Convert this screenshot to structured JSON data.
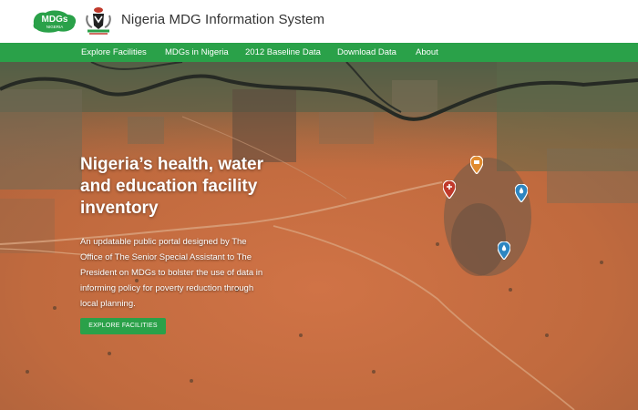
{
  "header": {
    "logo_text": "MDGs",
    "logo_subtext": "NIGERIA",
    "title": "Nigeria MDG Information System"
  },
  "nav": {
    "items": [
      {
        "label": "Explore Facilities"
      },
      {
        "label": "MDGs in Nigeria"
      },
      {
        "label": "2012 Baseline Data"
      },
      {
        "label": "Download Data"
      },
      {
        "label": "About"
      }
    ]
  },
  "hero": {
    "title": "Nigeria’s health, water and education facility inventory",
    "description": "An updatable public portal designed by The Office of The Senior Special Assistant to The President on MDGs to bolster the use of data in informing policy for poverty reduction through local planning.",
    "cta_label": "EXPLORE FACILITIES"
  },
  "map_pins": [
    {
      "type": "health",
      "color": "#c0392b",
      "icon": "plus-icon"
    },
    {
      "type": "education",
      "color": "#e08a2e",
      "icon": "book-icon"
    },
    {
      "type": "water",
      "color": "#2e86c1",
      "icon": "water-drop-icon"
    },
    {
      "type": "water",
      "color": "#2e86c1",
      "icon": "water-drop-icon"
    }
  ],
  "colors": {
    "brand_green": "#2aa149",
    "terrain": "#c56a3f",
    "health": "#c0392b",
    "education": "#e08a2e",
    "water": "#2e86c1"
  }
}
